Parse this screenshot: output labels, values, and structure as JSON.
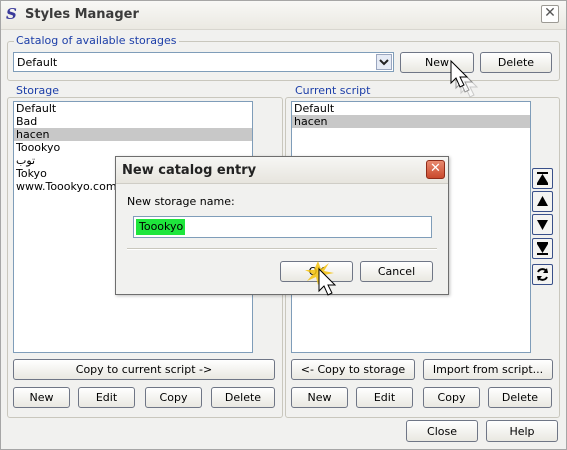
{
  "window": {
    "title": "Styles Manager",
    "close_glyph": "✕",
    "app_icon": "S"
  },
  "catalog": {
    "label": "Catalog of available storages",
    "selected": "Default",
    "new_label": "New",
    "delete_label": "Delete"
  },
  "storage": {
    "label": "Storage",
    "items": [
      "Default",
      "Bad",
      "hacen",
      "Toookyo",
      "توب",
      "Tokyo",
      "www.Toookyo.com"
    ],
    "copy_label": "Copy to current script ->",
    "new_label": "New",
    "edit_label": "Edit",
    "copy_small_label": "Copy",
    "delete_label": "Delete"
  },
  "current_script": {
    "label": "Current script",
    "items": [
      "Default",
      "hacen"
    ],
    "copy_label": "<- Copy to storage",
    "import_label": "Import from script...",
    "new_label": "New",
    "edit_label": "Edit",
    "copy_small_label": "Copy",
    "delete_label": "Delete"
  },
  "side_icons": [
    "move-top-icon",
    "move-up-icon",
    "move-down-icon",
    "move-bottom-icon",
    "refresh-icon"
  ],
  "footer": {
    "close_label": "Close",
    "help_label": "Help"
  },
  "dialog": {
    "title": "New catalog entry",
    "close_glyph": "✕",
    "field_label": "New storage name:",
    "field_value": "Toookyo",
    "ok_label": "OK",
    "cancel_label": "Cancel"
  },
  "colors": {
    "accent": "#1c3ea8",
    "selection": "#c8c8c8",
    "text_highlight": "#1ee63c"
  }
}
